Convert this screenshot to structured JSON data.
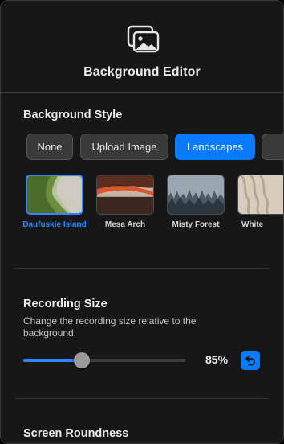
{
  "header": {
    "title": "Background Editor",
    "icon": "photos-icon"
  },
  "background_style": {
    "title": "Background Style",
    "buttons": [
      {
        "label": "None",
        "active": false
      },
      {
        "label": "Upload Image",
        "active": false
      },
      {
        "label": "Landscapes",
        "active": true
      },
      {
        "label": "",
        "active": false
      }
    ],
    "thumbnails": [
      {
        "label": "Daufuskie Island",
        "selected": true
      },
      {
        "label": "Mesa Arch",
        "selected": false
      },
      {
        "label": "Misty Forest",
        "selected": false
      },
      {
        "label": "White",
        "selected": false
      }
    ]
  },
  "recording_size": {
    "title": "Recording Size",
    "description": "Change the recording size relative to the background.",
    "value_label": "85%",
    "slider_fraction": 0.36,
    "reset_icon": "reset-arrow-icon"
  },
  "screen_roundness": {
    "title": "Screen Roundness"
  },
  "colors": {
    "accent": "#0a7aff",
    "panel": "#171717",
    "button": "#3a3a3a"
  }
}
